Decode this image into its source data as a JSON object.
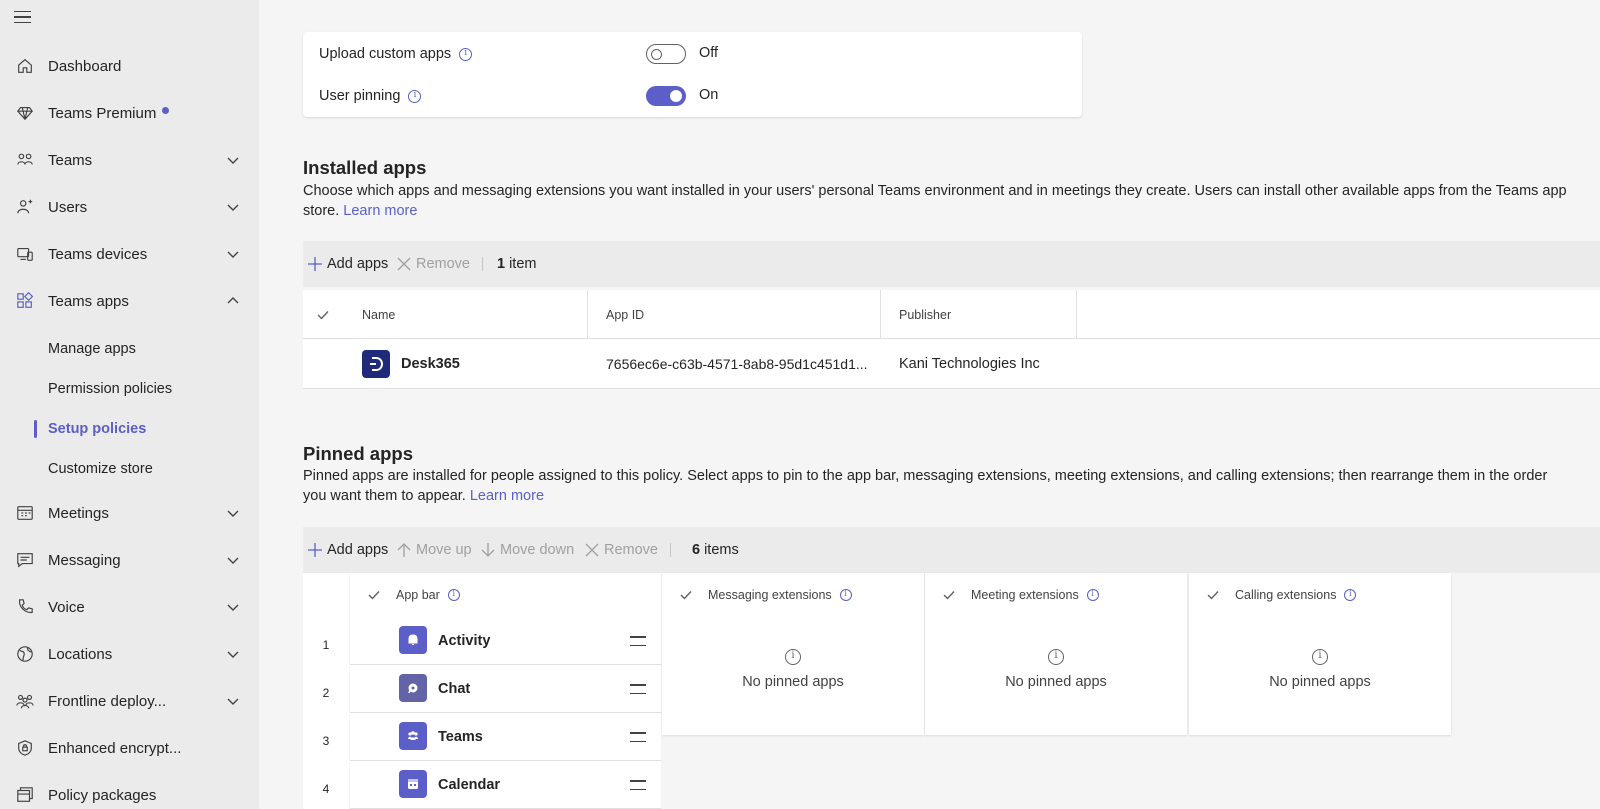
{
  "sidebar": {
    "items": [
      {
        "label": "Dashboard",
        "icon": "home-icon"
      },
      {
        "label": "Teams Premium",
        "icon": "diamond-icon"
      },
      {
        "label": "Teams",
        "icon": "people-team-icon"
      },
      {
        "label": "Users",
        "icon": "person-icon"
      },
      {
        "label": "Teams devices",
        "icon": "devices-icon"
      },
      {
        "label": "Teams apps",
        "icon": "apps-icon"
      },
      {
        "label": "Meetings",
        "icon": "calendar-icon"
      },
      {
        "label": "Messaging",
        "icon": "chat-icon"
      },
      {
        "label": "Voice",
        "icon": "phone-icon"
      },
      {
        "label": "Locations",
        "icon": "globe-icon"
      },
      {
        "label": "Frontline deploy...",
        "icon": "frontline-icon"
      },
      {
        "label": "Enhanced encrypt...",
        "icon": "shield-lock-icon"
      },
      {
        "label": "Policy packages",
        "icon": "package-icon"
      }
    ],
    "sub_items": [
      {
        "label": "Manage apps"
      },
      {
        "label": "Permission policies"
      },
      {
        "label": "Setup policies",
        "active": true
      },
      {
        "label": "Customize store"
      }
    ]
  },
  "settings": {
    "upload_custom_apps": {
      "label": "Upload custom apps",
      "state": "Off"
    },
    "user_pinning": {
      "label": "User pinning",
      "state": "On"
    }
  },
  "installed": {
    "title": "Installed apps",
    "desc": "Choose which apps and messaging extensions you want installed in your users' personal Teams environment and in meetings they create. Users can install other available apps from the Teams app store.",
    "learn_more": "Learn more",
    "toolbar": {
      "add": "Add apps",
      "remove": "Remove",
      "count_num": "1",
      "count_label": "item"
    },
    "columns": {
      "name": "Name",
      "app_id": "App ID",
      "publisher": "Publisher"
    },
    "rows": [
      {
        "name": "Desk365",
        "app_id": "7656ec6e-c63b-4571-8ab8-95d1c451d1...",
        "publisher": "Kani Technologies Inc",
        "color": "#1f2a7a"
      }
    ]
  },
  "pinned": {
    "title": "Pinned apps",
    "desc": "Pinned apps are installed for people assigned to this policy. Select apps to pin to the app bar, messaging extensions, meeting extensions, and calling extensions; then rearrange them in the order you want them to appear.",
    "learn_more": "Learn more",
    "toolbar": {
      "add": "Add apps",
      "move_up": "Move up",
      "move_down": "Move down",
      "remove": "Remove",
      "count_num": "6",
      "count_label": "items"
    },
    "columns": {
      "app_bar": "App bar",
      "messaging": "Messaging extensions",
      "meeting": "Meeting extensions",
      "calling": "Calling extensions"
    },
    "empty_text": "No pinned apps",
    "apps": [
      {
        "num": "1",
        "name": "Activity",
        "icon": "bell-icon"
      },
      {
        "num": "2",
        "name": "Chat",
        "icon": "chat-bubble-icon"
      },
      {
        "num": "3",
        "name": "Teams",
        "icon": "teams-icon"
      },
      {
        "num": "4",
        "name": "Calendar",
        "icon": "calendar-icon"
      }
    ]
  },
  "colors": {
    "accent": "#5b5fc7",
    "sidebar_bg": "#ebebeb",
    "page_bg": "#f5f5f5"
  }
}
